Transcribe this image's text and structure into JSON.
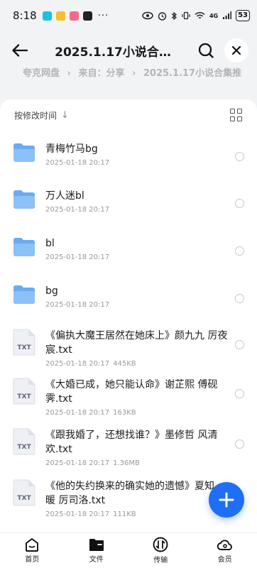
{
  "status": {
    "time": "8:18",
    "more": "···",
    "network": "4G",
    "battery": "53",
    "app_colors": [
      "#19c3e8",
      "#f5c02c",
      "#f46a87",
      "#222222"
    ]
  },
  "header": {
    "title": "2025.1.17小说合…"
  },
  "breadcrumb": {
    "items": [
      "夸克网盘",
      "›",
      "来自：分享",
      "›",
      "2025.1.17小说合集推"
    ]
  },
  "sort": {
    "label": "按修改时间",
    "arrow": "↓"
  },
  "files": [
    {
      "name": "青梅竹马bg",
      "date": "2025-01-18 20:17",
      "size": "",
      "type": "folder"
    },
    {
      "name": "万人迷bl",
      "date": "2025-01-18 20:17",
      "size": "",
      "type": "folder"
    },
    {
      "name": "bl",
      "date": "2025-01-18 20:17",
      "size": "",
      "type": "folder"
    },
    {
      "name": "bg",
      "date": "2025-01-18 20:17",
      "size": "",
      "type": "folder"
    },
    {
      "name": "《偏执大魔王居然在她床上》颜九九 厉夜宸.txt",
      "date": "2025-01-18 20:17",
      "size": "445KB",
      "type": "txt"
    },
    {
      "name": "《大婚已成，她只能认命》谢芷熙 傅砚霁.txt",
      "date": "2025-01-18 20:17",
      "size": "163KB",
      "type": "txt"
    },
    {
      "name": "《跟我婚了，还想找谁？》墨修哲 风清欢.txt",
      "date": "2025-01-18 20:17",
      "size": "1.36MB",
      "type": "txt"
    },
    {
      "name": "《他的失约换来的确实她的遗憾》夏知暖 厉司洛.txt",
      "date": "2025-01-18 20:17",
      "size": "111KB",
      "type": "txt"
    }
  ],
  "txt_badge": "TXT",
  "fab_label": "+",
  "tabs": [
    {
      "label": "首页",
      "icon": "home-icon"
    },
    {
      "label": "文件",
      "icon": "folder-icon"
    },
    {
      "label": "传输",
      "icon": "transfer-icon"
    },
    {
      "label": "会员",
      "icon": "cloud-icon"
    }
  ],
  "colors": {
    "accent": "#1e6ff5",
    "folder": "#6aabf2",
    "background": "#f2f3f5"
  }
}
